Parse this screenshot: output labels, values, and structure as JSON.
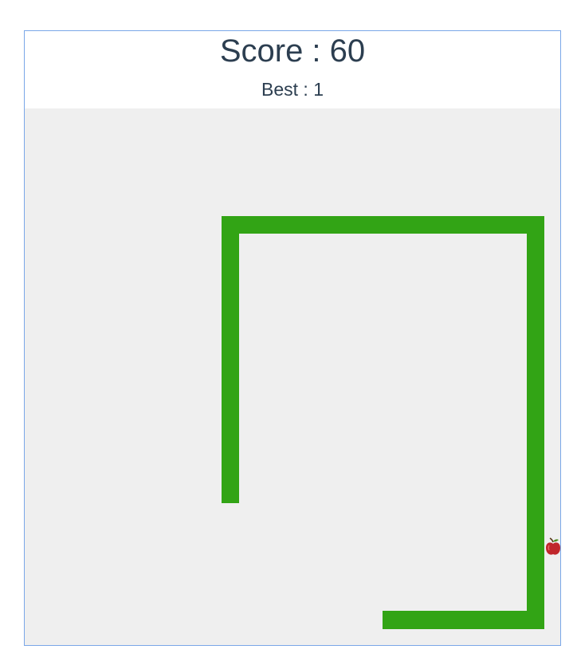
{
  "game": {
    "score_text": "Score : 60",
    "best_text": "Best : 1",
    "colors": {
      "snake": "#32a415",
      "board": "#efefef",
      "frame_border": "#7aa7e8",
      "apple": "#c0262b",
      "text": "#2c3e50"
    },
    "food_icon": "apple-icon"
  }
}
